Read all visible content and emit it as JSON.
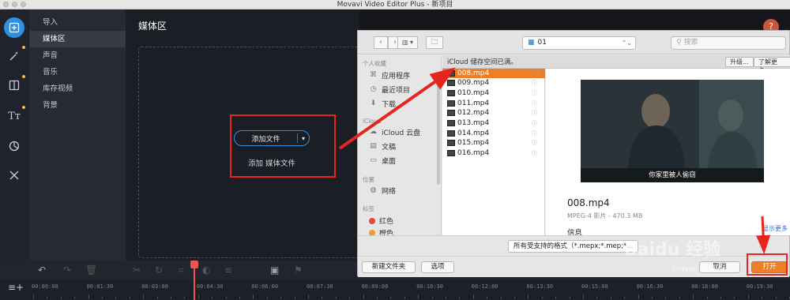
{
  "window": {
    "title": "Movavi Video Editor Plus - 新项目"
  },
  "sidebar": {
    "items": [
      {
        "label": "导入"
      },
      {
        "label": "媒体区"
      },
      {
        "label": "声音"
      },
      {
        "label": "音乐"
      },
      {
        "label": "库存视频"
      },
      {
        "label": "背景"
      }
    ]
  },
  "media": {
    "heading": "媒体区",
    "add_file_button": "添加文件",
    "add_media_text": "添加 媒体文件"
  },
  "help_label": "?",
  "timeline": {
    "ticks": [
      "00:00:00",
      "00:01:30",
      "00:03:00",
      "00:04:30",
      "00:06:00",
      "00:07:30",
      "00:09:00",
      "00:10:30",
      "00:12:00",
      "00:13:30",
      "00:15:00",
      "00:16:30",
      "00:18:00",
      "00:19:30"
    ]
  },
  "dialog": {
    "folder": "01",
    "search_placeholder": "搜索",
    "sidebar": {
      "favorites_header": "个人收藏",
      "favorites": [
        "应用程序",
        "最近项目",
        "下载"
      ],
      "icloud_header": "iCloud",
      "icloud": [
        "iCloud 云盘",
        "文稿",
        "桌面"
      ],
      "locations_header": "位置",
      "locations": [
        "网络"
      ],
      "tags_header": "标签",
      "tags": [
        {
          "label": "红色",
          "color": "#e8473f"
        },
        {
          "label": "橙色",
          "color": "#f39a2b"
        }
      ]
    },
    "icloud_bar": {
      "message": "iCloud 储存空间已满。",
      "upgrade": "升级...",
      "learn_more": "了解更多..."
    },
    "files": [
      "008.mp4",
      "009.mp4",
      "010.mp4",
      "011.mp4",
      "012.mp4",
      "013.mp4",
      "014.mp4",
      "015.mp4",
      "016.mp4"
    ],
    "selected_file": "008.mp4",
    "preview": {
      "subtitle": "你家里被人偷窃",
      "name": "008.mp4",
      "meta": "MPEG-4 影片 - 470.3 MB",
      "info_header": "信息",
      "more": "显示更多"
    },
    "format": "所有受支持的格式（*.mepx;*.mep;*...",
    "buttons": {
      "new_folder": "新建文件夹",
      "options": "选项",
      "cancel": "取消",
      "open": "打开"
    }
  },
  "watermark": {
    "brand": "Baidu 经验",
    "url": "jingyan.baidu.com"
  },
  "colors": {
    "accent": "#2f8fe0",
    "highlight": "#e8241f",
    "finder_select": "#ef7f27"
  }
}
